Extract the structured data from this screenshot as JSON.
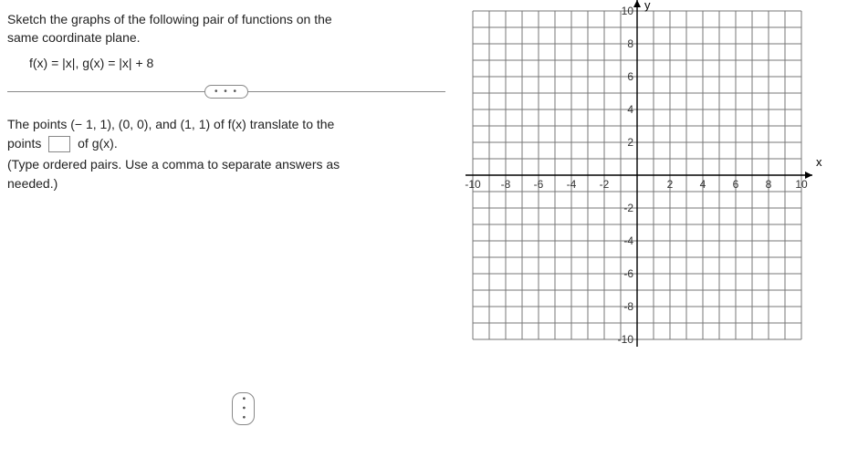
{
  "prompt": {
    "line1": "Sketch the graphs of the following pair of functions on the",
    "line2": "same coordinate plane."
  },
  "functions": "f(x) = |x|, g(x) = |x| + 8",
  "dots": "• • •",
  "question": {
    "part1": "The points (− 1, 1), (0, 0), and (1, 1) of f(x) translate to the",
    "part2a": "points",
    "part2b": "of g(x)."
  },
  "hint": {
    "line1": "(Type ordered pairs. Use a comma to separate answers as",
    "line2": "needed.)"
  },
  "graph": {
    "xlabel": "x",
    "ylabel": "y",
    "x_ticks": [
      "-10",
      "-8",
      "-6",
      "-4",
      "-2",
      "2",
      "4",
      "6",
      "8",
      "10"
    ],
    "y_ticks_pos": [
      "10",
      "8",
      "6",
      "4",
      "2"
    ],
    "y_ticks_neg": [
      "-2",
      "-4",
      "-6",
      "-8",
      "-10"
    ]
  },
  "chart_data": {
    "type": "line",
    "title": "",
    "xlabel": "x",
    "ylabel": "y",
    "xlim": [
      -10,
      10
    ],
    "ylim": [
      -10,
      10
    ],
    "series": []
  }
}
